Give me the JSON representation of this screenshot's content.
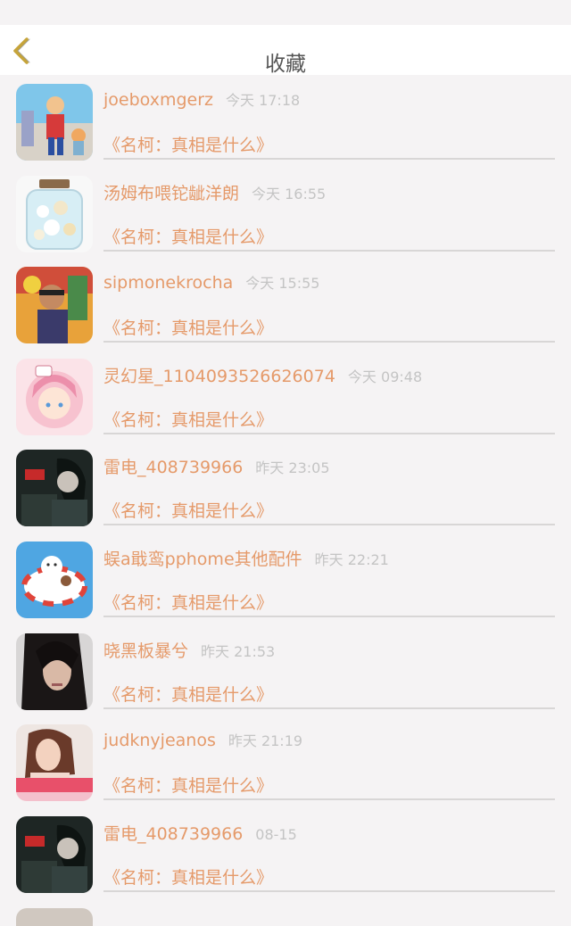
{
  "header": {
    "title": "收藏"
  },
  "items": [
    {
      "username": "joeboxmgerz",
      "time": "今天 17:18",
      "title": "《名柯：真相是什么》"
    },
    {
      "username": "汤姆布喂铊龇洋朗",
      "time": "今天 16:55",
      "title": "《名柯：真相是什么》"
    },
    {
      "username": "sipmonekrocha",
      "time": "今天 15:55",
      "title": "《名柯：真相是什么》"
    },
    {
      "username": "灵幻星_1104093526626074",
      "time": "今天 09:48",
      "title": "《名柯：真相是什么》"
    },
    {
      "username": "雷电_408739966",
      "time": "昨天 23:05",
      "title": "《名柯：真相是什么》"
    },
    {
      "username": "蜈a戢鸾pphome其他配件",
      "time": "昨天 22:21",
      "title": "《名柯：真相是什么》"
    },
    {
      "username": "晓黑板暴兮",
      "time": "昨天 21:53",
      "title": "《名柯：真相是什么》"
    },
    {
      "username": "judknyjeanos",
      "time": "昨天 21:19",
      "title": "《名柯：真相是什么》"
    },
    {
      "username": "雷电_408739966",
      "time": "08-15",
      "title": "《名柯：真相是什么》"
    }
  ],
  "colors": {
    "accent": "#e59a6a",
    "time": "#c4c4c4",
    "back_icon": "#c6a43a",
    "background": "#f5f3f4"
  },
  "icons": {
    "back": "chevron-left-icon"
  }
}
